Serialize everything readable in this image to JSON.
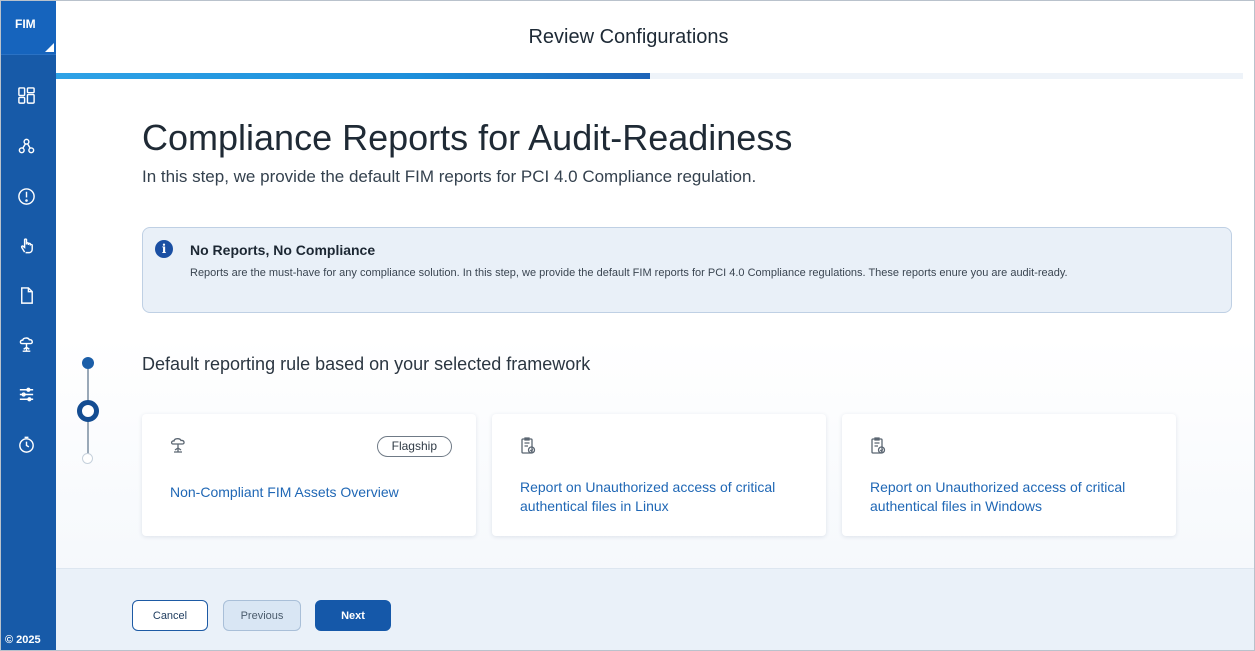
{
  "sidebar": {
    "brand": "FIM",
    "items": [
      {
        "icon": "dashboard-icon"
      },
      {
        "icon": "network-icon"
      },
      {
        "icon": "alert-icon"
      },
      {
        "icon": "touch-icon"
      },
      {
        "icon": "document-icon"
      },
      {
        "icon": "cloud-tree-icon"
      },
      {
        "icon": "sliders-icon"
      },
      {
        "icon": "clock-icon"
      }
    ],
    "copyright": "© 2025"
  },
  "header": {
    "title": "Review Configurations",
    "progress": 0.5
  },
  "main": {
    "title": "Compliance Reports for Audit-Readiness",
    "subtitle": "In this step, we provide the default FIM reports for PCI 4.0 Compliance regulation.",
    "info": {
      "icon": "info-icon",
      "title": "No Reports, No Compliance",
      "text": "Reports are the must-have for any compliance solution. In this step, we provide the default FIM reports for PCI 4.0 Compliance regulations. These reports enure you are audit-ready."
    },
    "section_heading": "Default reporting rule based on your selected framework",
    "cards": [
      {
        "icon": "asset-icon",
        "badge": "Flagship",
        "title": "Non-Compliant FIM Assets Overview"
      },
      {
        "icon": "report-icon",
        "title": "Report on Unauthorized access of critical authentical files in Linux"
      },
      {
        "icon": "report-icon",
        "title": "Report on Unauthorized access of critical authentical files in Windows"
      }
    ]
  },
  "footer": {
    "cancel_label": "Cancel",
    "previous_label": "Previous",
    "next_label": "Next"
  },
  "colors": {
    "sidebar": "#175aa8",
    "accent": "#1558a9",
    "link": "#1f67b5"
  }
}
